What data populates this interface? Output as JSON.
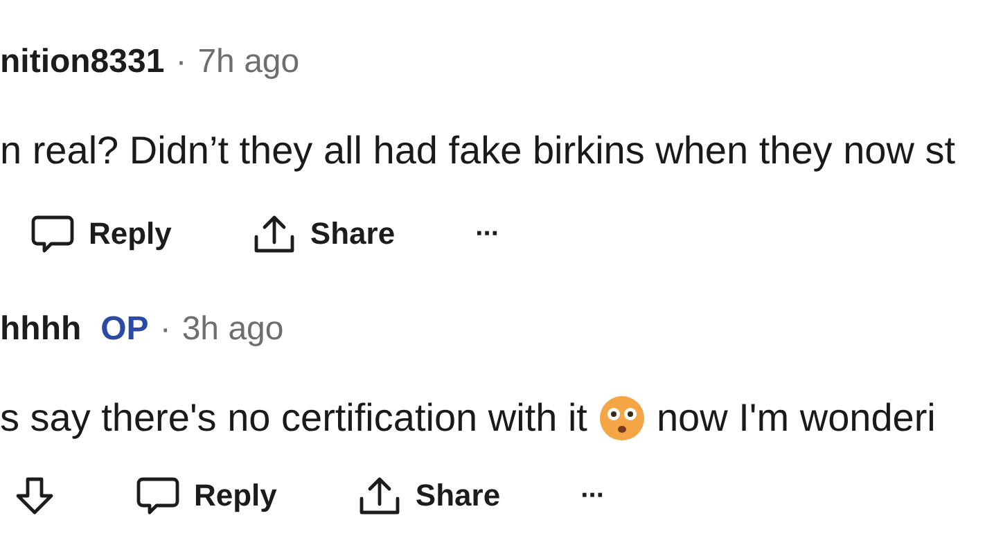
{
  "comments": [
    {
      "author": "nition8331",
      "separator": "·",
      "time": "7h ago",
      "body": [
        {
          "kind": "text",
          "text": "n real? Didn’t they all had fake birkins when they now st"
        }
      ],
      "actions": [
        {
          "kind": "reply",
          "label": "Reply"
        },
        {
          "kind": "share",
          "label": "Share"
        },
        {
          "kind": "more",
          "label": "···"
        }
      ]
    },
    {
      "author": "hhhh",
      "badge": "OP",
      "separator": "·",
      "time": "3h ago",
      "body": [
        {
          "kind": "text",
          "text": "s say there's no certification with it"
        },
        {
          "kind": "emoji"
        },
        {
          "kind": "text",
          "text": "now I'm wonderi"
        }
      ],
      "actions": [
        {
          "kind": "downvote"
        },
        {
          "kind": "reply",
          "label": "Reply"
        },
        {
          "kind": "share",
          "label": "Share"
        },
        {
          "kind": "more",
          "label": "···"
        }
      ]
    }
  ]
}
